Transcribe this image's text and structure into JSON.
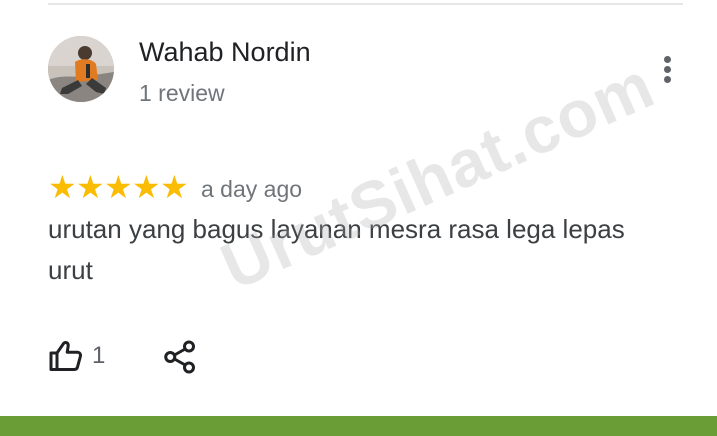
{
  "review": {
    "reviewer_name": "Wahab Nordin",
    "review_count": "1 review",
    "rating": 5,
    "rating_max": 5,
    "time": "a day ago",
    "text": "urutan yang bagus layanan mesra rasa lega lepas urut",
    "like_count": "1"
  },
  "icons": {
    "more": "more-vert-icon",
    "like": "thumb-up-icon",
    "share": "share-icon",
    "star": "star-icon"
  },
  "watermark": "UrutSihat.com",
  "colors": {
    "star": "#fbbc04",
    "secondary_text": "#70757a",
    "bottom_bar": "#6a9d35"
  }
}
